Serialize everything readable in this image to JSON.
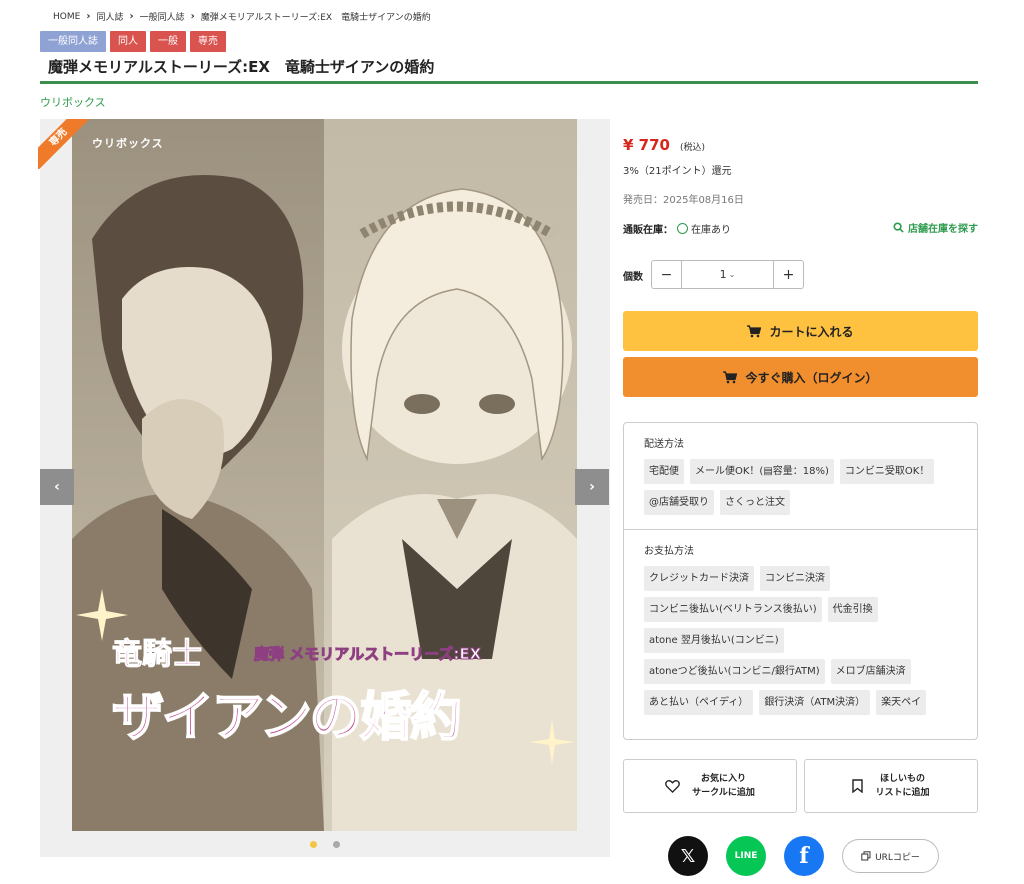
{
  "breadcrumb": {
    "items": [
      "HOME",
      "同人誌",
      "一般同人誌",
      "魔弾メモリアルストーリーズ:EX　竜騎士ザイアンの婚約"
    ],
    "separator": "›"
  },
  "tags": [
    {
      "label": "一般同人誌",
      "color": "#8fa2d4"
    },
    {
      "label": "同人",
      "color": "#d9534f"
    },
    {
      "label": "一般",
      "color": "#d9534f"
    },
    {
      "label": "専売",
      "color": "#d9534f"
    }
  ],
  "product": {
    "title": "魔弾メモリアルストーリーズ:EX　竜騎士ザイアンの婚約",
    "circle": "ウリボックス",
    "price": "¥ 770",
    "tax_note": "(税込)",
    "points": "3%（21ポイント）還元",
    "release_date": "発売日：2025年08月16日",
    "stock_label": "通販在庫：",
    "stock_value": "在庫あり",
    "store_stock_link": "店舗在庫を探す",
    "quantity_label": "個数",
    "quantity_value": "1"
  },
  "gallery": {
    "ribbon": "専売",
    "cover": {
      "circle": "ウリボックス",
      "series": "魔弾 メモリアルストーリーズ:EX",
      "title_line1": "竜騎士",
      "title_line2": "ザイアンの婚約"
    },
    "prev_label": "‹",
    "next_label": "›",
    "slide_count": 2,
    "active_slide": 1
  },
  "actions": {
    "cart": "カートに入れる",
    "buy_now": "今すぐ購入（ログイン）",
    "minus": "−",
    "plus": "+"
  },
  "shipping": {
    "heading": "配送方法",
    "methods": [
      "宅配便",
      "メール便OK！(▤容量：18%)",
      "コンビニ受取OK！",
      "@店舗受取り",
      "さくっと注文"
    ]
  },
  "payment": {
    "heading": "お支払方法",
    "methods": [
      "クレジットカード決済",
      "コンビニ決済",
      "コンビニ後払い(ベリトランス後払い)",
      "代金引換",
      "atone 翌月後払い(コンビニ)",
      "atoneつど後払い(コンビニ/銀行ATM)",
      "メロブ店舗決済",
      "あと払い（ペイディ）",
      "銀行決済（ATM決済）",
      "楽天ペイ"
    ]
  },
  "favorites": {
    "circle_line1": "お気に入り",
    "circle_line2": "サークルに追加",
    "wishlist_line1": "ほしいもの",
    "wishlist_line2": "リストに追加"
  },
  "share": {
    "x": "𝕏",
    "line": "LINE",
    "facebook": "f",
    "url_copy": "URLコピー"
  },
  "colors": {
    "accent_green": "#3b8e4b",
    "price_red": "#d9261c",
    "cart_yellow": "#fec140",
    "buy_orange": "#f18e2e"
  }
}
